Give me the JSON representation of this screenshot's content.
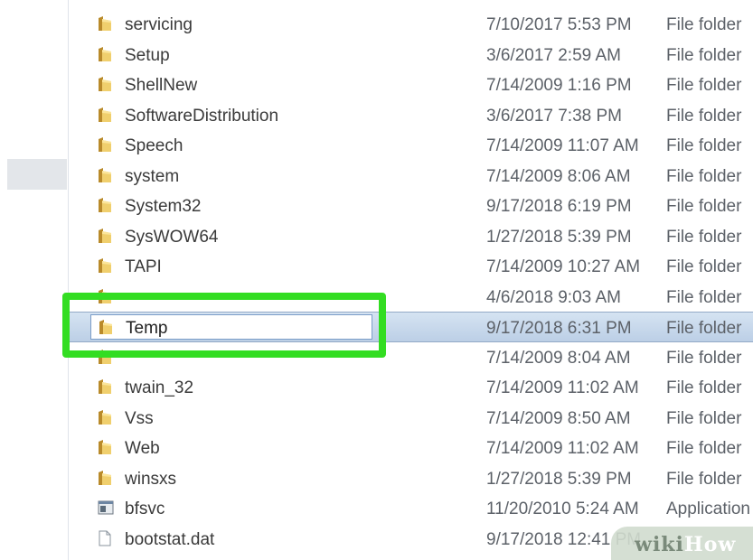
{
  "files": [
    {
      "name": "servicing",
      "date": "7/10/2017 5:53 PM",
      "type": "File folder",
      "icon": "folder-icon"
    },
    {
      "name": "Setup",
      "date": "3/6/2017 2:59 AM",
      "type": "File folder",
      "icon": "folder-icon"
    },
    {
      "name": "ShellNew",
      "date": "7/14/2009 1:16 PM",
      "type": "File folder",
      "icon": "folder-icon"
    },
    {
      "name": "SoftwareDistribution",
      "date": "3/6/2017 7:38 PM",
      "type": "File folder",
      "icon": "folder-icon"
    },
    {
      "name": "Speech",
      "date": "7/14/2009 11:07 AM",
      "type": "File folder",
      "icon": "folder-icon"
    },
    {
      "name": "system",
      "date": "7/14/2009 8:06 AM",
      "type": "File folder",
      "icon": "folder-icon"
    },
    {
      "name": "System32",
      "date": "9/17/2018 6:19 PM",
      "type": "File folder",
      "icon": "folder-icon"
    },
    {
      "name": "SysWOW64",
      "date": "1/27/2018 5:39 PM",
      "type": "File folder",
      "icon": "folder-icon"
    },
    {
      "name": "TAPI",
      "date": "7/14/2009 10:27 AM",
      "type": "File folder",
      "icon": "folder-icon"
    },
    {
      "name": "",
      "date": "4/6/2018 9:03 AM",
      "type": "File folder",
      "icon": "folder-icon"
    },
    {
      "name": "Temp",
      "date": "9/17/2018 6:31 PM",
      "type": "File folder",
      "icon": "folder-icon",
      "selected": true
    },
    {
      "name": "",
      "date": "7/14/2009 8:04 AM",
      "type": "File folder",
      "icon": "folder-icon"
    },
    {
      "name": "twain_32",
      "date": "7/14/2009 11:02 AM",
      "type": "File folder",
      "icon": "folder-icon"
    },
    {
      "name": "Vss",
      "date": "7/14/2009 8:50 AM",
      "type": "File folder",
      "icon": "folder-icon"
    },
    {
      "name": "Web",
      "date": "7/14/2009 11:02 AM",
      "type": "File folder",
      "icon": "folder-icon"
    },
    {
      "name": "winsxs",
      "date": "1/27/2018 5:39 PM",
      "type": "File folder",
      "icon": "folder-icon"
    },
    {
      "name": "bfsvc",
      "date": "11/20/2010 5:24 AM",
      "type": "Application",
      "icon": "application-icon"
    },
    {
      "name": "bootstat.dat",
      "date": "9/17/2018 12:41 PM",
      "type": "",
      "icon": "file-icon"
    }
  ],
  "watermark": {
    "wiki": "wiki",
    "how": "How"
  },
  "colors": {
    "highlight": "#33dd22",
    "selection": "#c9daee",
    "folder": "#e8c15a"
  }
}
